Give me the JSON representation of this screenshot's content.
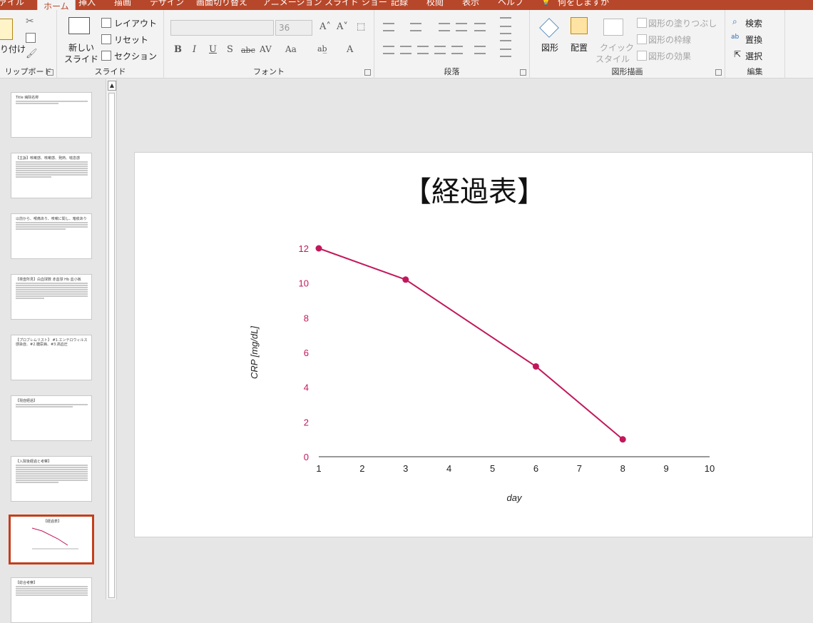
{
  "tabs": [
    "ァイル",
    "ホーム",
    "挿入",
    "描画",
    "デザイン",
    "画面切り替え",
    "アニメーション",
    "スライド ショー",
    "記録",
    "校閲",
    "表示",
    "ヘルプ",
    "何をしますか"
  ],
  "ribbon": {
    "clipboard": {
      "label": "リップボード",
      "paste": "り付け"
    },
    "slides": {
      "label": "スライド",
      "new_slide": "新しい\nスライド",
      "new_slide_l1": "新しい",
      "new_slide_l2": "スライド",
      "layout": "レイアウト",
      "reset": "リセット",
      "section": "セクション"
    },
    "font": {
      "label": "フォント",
      "font_name": "",
      "font_size": "36",
      "bold": "B",
      "italic": "I",
      "underline": "U",
      "shadow": "S",
      "strike": "abc",
      "spacing": "AV",
      "case": "Aa",
      "color": "A"
    },
    "paragraph": {
      "label": "段落"
    },
    "drawing": {
      "label": "図形描画",
      "shapes": "図形",
      "arrange": "配置",
      "quick_style_l1": "クイック",
      "quick_style_l2": "スタイル",
      "fill": "図形の塗りつぶし",
      "outline": "図形の枠線",
      "effects": "図形の効果"
    },
    "editing": {
      "label": "編集",
      "find": "検索",
      "replace": "置換",
      "select": "選択"
    }
  },
  "thumbnails": [
    {
      "title": "Title 病院名称",
      "lines": 2
    },
    {
      "title": "【主訴】咳嗽感、咳嗽感、発熱、喘息感",
      "lines": 8
    },
    {
      "title": "以前から、喉痛あり、咳嗽に関し、喀痰あり",
      "lines": 4
    },
    {
      "title": "【検査所見】白血球数 赤血球 Hb 血小板",
      "lines": 8
    },
    {
      "title": "【プロブレムリスト】 #1.エンテロウィルス感染症、#2.糖尿病、#3.高血圧",
      "lines": 1
    },
    {
      "title": "【現症経過】",
      "lines": 2
    },
    {
      "title": "【入院後経過と考察】",
      "lines": 9
    },
    {
      "title": "【経過表】",
      "lines": 0
    },
    {
      "title": "【総合考察】",
      "lines": 5
    }
  ],
  "slide": {
    "title": "【経過表】"
  },
  "chart_data": {
    "type": "line",
    "title": "",
    "xlabel": "day",
    "ylabel": "CRP [mg/dL]",
    "x_ticks": [
      1,
      2,
      3,
      4,
      5,
      6,
      7,
      8,
      9,
      10
    ],
    "y_ticks": [
      0,
      2,
      4,
      6,
      8,
      10,
      12
    ],
    "xlim": [
      1,
      10
    ],
    "ylim": [
      0,
      12
    ],
    "grid": false,
    "series": [
      {
        "x": [
          1,
          3,
          6,
          8
        ],
        "y": [
          12,
          10.2,
          5.2,
          1
        ],
        "color": "#c2185b"
      }
    ]
  }
}
